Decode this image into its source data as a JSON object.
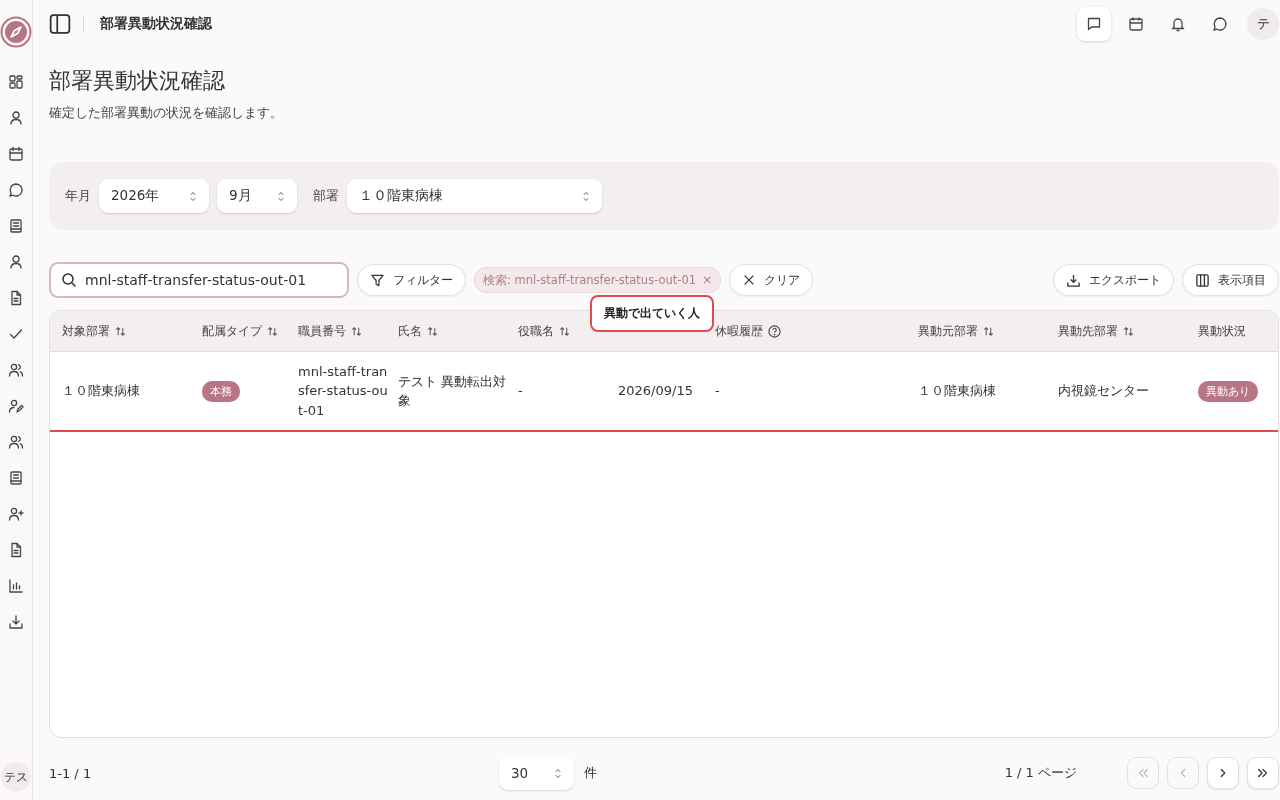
{
  "header": {
    "title": "部署異動状況確認",
    "avatar": "テ"
  },
  "page": {
    "title": "部署異動状況確認",
    "description": "確定した部署異動の状況を確認します。"
  },
  "filters": {
    "year_label": "年月",
    "year": "2026年",
    "month": "9月",
    "dept_label": "部署",
    "dept": "１０階東病棟"
  },
  "toolbar": {
    "search_value": "mnl-staff-transfer-status-out-01",
    "filter_button": "フィルター",
    "chip": "検索: mnl-staff-transfer-status-out-01",
    "chip_close": "×",
    "clear_button": "クリア",
    "export_button": "エクスポート",
    "columns_button": "表示項目"
  },
  "table": {
    "columns": [
      {
        "kind": "label",
        "label": "対象部署",
        "sortable": true
      },
      {
        "kind": "label",
        "label": "配属タイプ",
        "sortable": true
      },
      {
        "kind": "label",
        "label": "職員番号",
        "sortable": true
      },
      {
        "kind": "label",
        "label": "氏名",
        "sortable": true
      },
      {
        "kind": "label",
        "label": "役職名",
        "sortable": true
      },
      {
        "kind": "covered"
      },
      {
        "kind": "label",
        "label": "休暇履歴",
        "sortable": false,
        "help": true
      },
      {
        "kind": "label",
        "label": "異動元部署",
        "sortable": true
      },
      {
        "kind": "label",
        "label": "異動先部署",
        "sortable": true
      },
      {
        "kind": "label",
        "label": "異動状況",
        "sortable": false
      }
    ],
    "rows": [
      {
        "highlighted": true,
        "cells": [
          {
            "kind": "text",
            "text": "１０階東病棟"
          },
          {
            "kind": "badge",
            "text": "本務"
          },
          {
            "kind": "text",
            "text": "mnl-staff-transfer-status-out-01"
          },
          {
            "kind": "text",
            "text": "テスト 異動転出対象"
          },
          {
            "kind": "text",
            "text": "-"
          },
          {
            "kind": "text",
            "text": "2026/09/15"
          },
          {
            "kind": "text",
            "text": "-"
          },
          {
            "kind": "text",
            "text": "１０階東病棟"
          },
          {
            "kind": "text",
            "text": "内視鏡センター"
          },
          {
            "kind": "badge",
            "text": "異動あり"
          }
        ]
      }
    ],
    "tooltip": "異動で出ていく人"
  },
  "footer": {
    "range": "1-1 / 1",
    "page_size": "30",
    "unit": "件",
    "page_info": "1 / 1 ページ",
    "nav": [
      {
        "kind": "first",
        "disabled": true
      },
      {
        "kind": "prev",
        "disabled": true
      },
      {
        "kind": "next",
        "disabled": false
      },
      {
        "kind": "last",
        "disabled": false
      }
    ]
  },
  "sidebar": {
    "avatar": "テス"
  }
}
